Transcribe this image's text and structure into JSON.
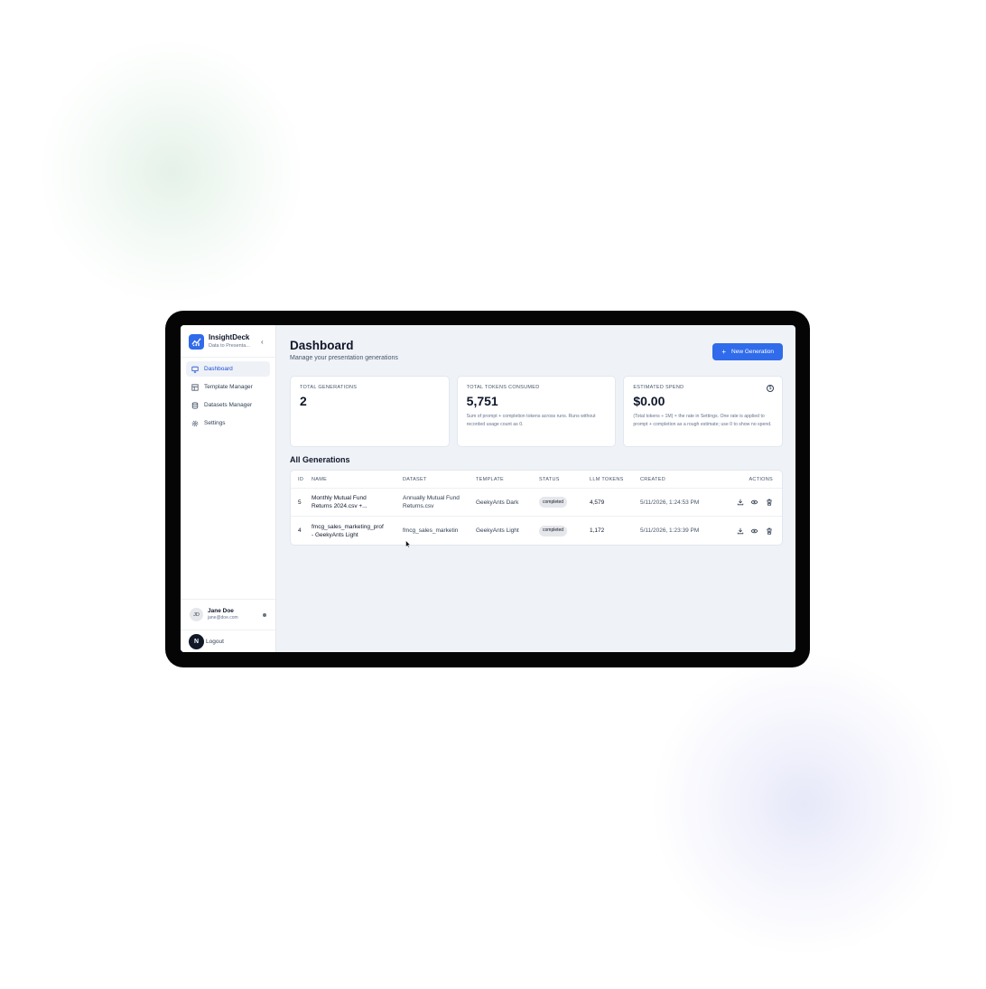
{
  "app": {
    "name": "InsightDeck",
    "tagline": "Data to Presenta...",
    "collapse_icon": "chevron-left-icon"
  },
  "sidebar": {
    "items": [
      {
        "label": "Dashboard",
        "icon": "monitor-icon",
        "active": true
      },
      {
        "label": "Template Manager",
        "icon": "layout-icon",
        "active": false
      },
      {
        "label": "Datasets Manager",
        "icon": "database-icon",
        "active": false
      },
      {
        "label": "Settings",
        "icon": "gear-icon",
        "active": false
      }
    ],
    "user": {
      "initials": "JD",
      "name": "Jane Doe",
      "email": "jane@doe.com"
    },
    "logout_label": "Logout",
    "next_badge": "N"
  },
  "header": {
    "title": "Dashboard",
    "subtitle": "Manage your presentation generations",
    "new_button_label": "New Generation"
  },
  "cards": [
    {
      "label": "TOTAL GENERATIONS",
      "value": "2",
      "note": ""
    },
    {
      "label": "TOTAL TOKENS CONSUMED",
      "value": "5,751",
      "note": "Sum of prompt + completion tokens across runs. Runs without recorded usage count as 0."
    },
    {
      "label": "ESTIMATED SPEND",
      "value": "$0.00",
      "note": "(Total tokens ÷ 1M) × the rate in Settings. One rate is applied to prompt + completion as a rough estimate; use 0 to show no spend."
    }
  ],
  "section_title": "All Generations",
  "table": {
    "headers": [
      "ID",
      "NAME",
      "DATASET",
      "TEMPLATE",
      "STATUS",
      "LLM TOKENS",
      "CREATED",
      "ACTIONS"
    ],
    "rows": [
      {
        "id": "5",
        "name_line1": "Monthly Mutual Fund",
        "name_line2": "Returns 2024.csv +...",
        "dataset_line1": "Annually Mutual Fund",
        "dataset_line2": "Returns.csv",
        "template": "GeekyAnts Dark",
        "status": "completed",
        "tokens": "4,579",
        "created": "5/11/2026, 1:24:53 PM"
      },
      {
        "id": "4",
        "name_line1": "fmcg_sales_marketing_prof",
        "name_line2": "- GeekyAnts Light",
        "dataset_line1": "fmcg_sales_marketin",
        "dataset_line2": "",
        "template": "GeekyAnts Light",
        "status": "completed",
        "tokens": "1,172",
        "created": "5/11/2026, 1:23:39 PM"
      }
    ]
  },
  "colors": {
    "accent": "#2f6bea",
    "background": "#eff2f6"
  }
}
